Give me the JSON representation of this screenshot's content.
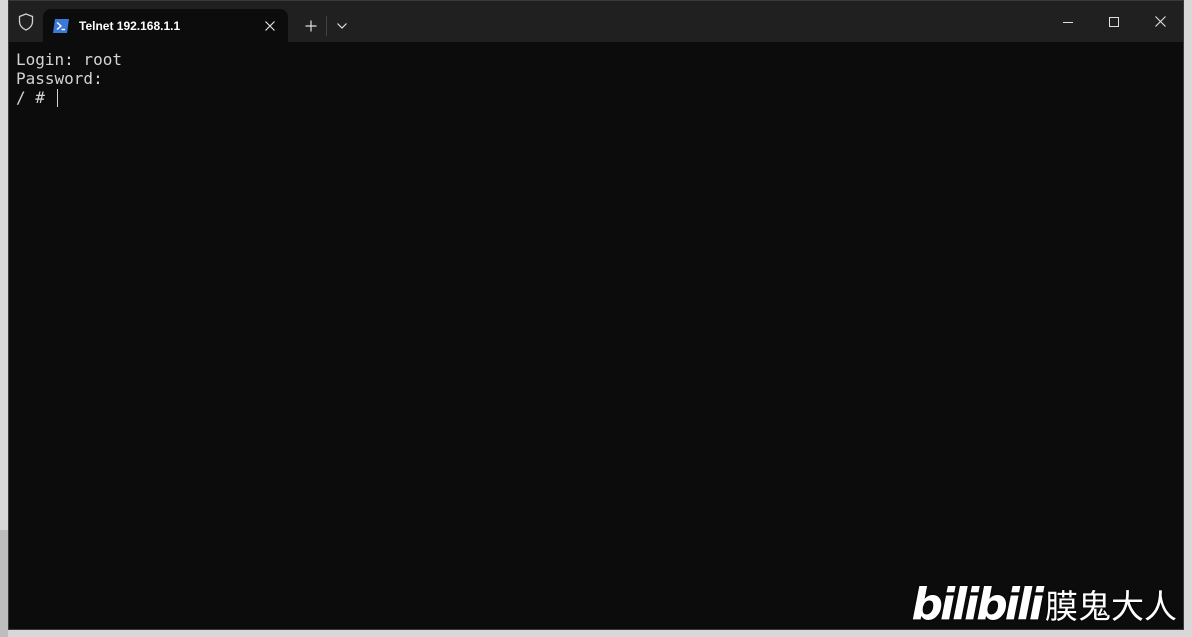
{
  "window": {
    "tab_title": "Telnet 192.168.1.1"
  },
  "terminal": {
    "lines": [
      "Login: root",
      "Password:",
      "/ #"
    ]
  },
  "watermark": {
    "logo_text": "bilibili",
    "author": "膜鬼大人"
  },
  "icons": {
    "shield": "shield-icon",
    "tab": "powershell-icon",
    "close_tab": "close-icon",
    "new_tab": "plus-icon",
    "dropdown": "chevron-down-icon",
    "minimize": "minimize-icon",
    "maximize": "maximize-icon",
    "close_window": "close-icon"
  },
  "colors": {
    "terminal_bg": "#0c0c0c",
    "titlebar_bg": "#202020",
    "text": "#d4d4d4",
    "tab_icon": "#3b78d8"
  }
}
